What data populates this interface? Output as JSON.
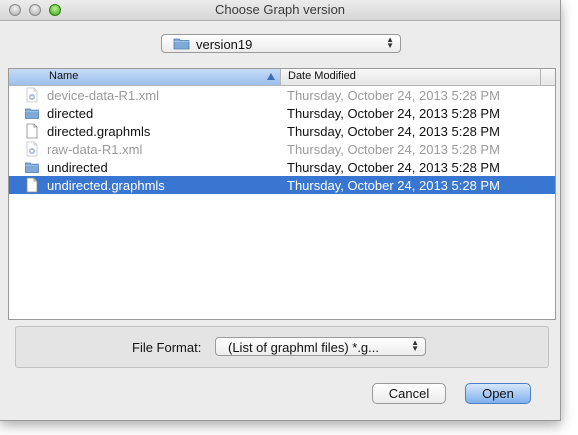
{
  "window": {
    "title": "Choose Graph version"
  },
  "location": {
    "selected": "version19"
  },
  "columns": {
    "name": "Name",
    "date": "Date Modified"
  },
  "files": [
    {
      "name": "device-data-R1.xml",
      "date": "Thursday, October 24, 2013 5:28 PM",
      "kind": "xml-file",
      "state": "disabled"
    },
    {
      "name": "directed",
      "date": "Thursday, October 24, 2013 5:28 PM",
      "kind": "folder",
      "state": "normal"
    },
    {
      "name": "directed.graphmls",
      "date": "Thursday, October 24, 2013 5:28 PM",
      "kind": "document",
      "state": "normal"
    },
    {
      "name": "raw-data-R1.xml",
      "date": "Thursday, October 24, 2013 5:28 PM",
      "kind": "xml-file",
      "state": "disabled"
    },
    {
      "name": "undirected",
      "date": "Thursday, October 24, 2013 5:28 PM",
      "kind": "folder",
      "state": "normal"
    },
    {
      "name": "undirected.graphmls",
      "date": "Thursday, October 24, 2013 5:28 PM",
      "kind": "document",
      "state": "selected"
    }
  ],
  "format": {
    "label": "File Format:",
    "selected": "(List of graphml files) *.g..."
  },
  "buttons": {
    "cancel": "Cancel",
    "open": "Open"
  },
  "colors": {
    "selection": "#3876d2",
    "folder": "#7ea9d8",
    "disabled_text": "#9b9b9b"
  }
}
